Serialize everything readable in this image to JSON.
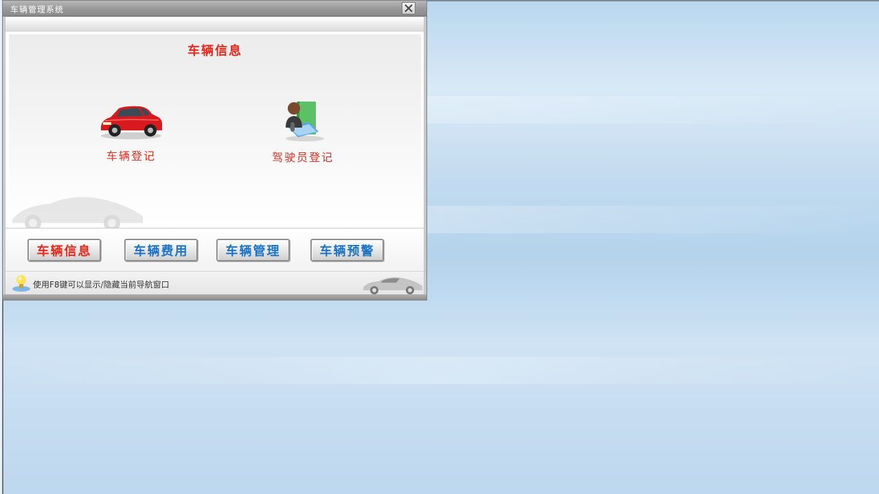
{
  "window": {
    "title": "车辆管理系统"
  },
  "panel": {
    "title": "车辆信息",
    "modules": [
      {
        "label": "车辆登记",
        "icon": "red-car-icon"
      },
      {
        "label": "驾驶员登记",
        "icon": "driver-book-icon"
      }
    ]
  },
  "nav_buttons": [
    {
      "label": "车辆信息",
      "state": "active"
    },
    {
      "label": "车辆费用",
      "state": "normal"
    },
    {
      "label": "车辆管理",
      "state": "normal"
    },
    {
      "label": "车辆预警",
      "state": "normal"
    }
  ],
  "status": {
    "text": "使用F8键可以显示/隐藏当前导航窗口",
    "icon": "lightbulb-icon"
  },
  "colors": {
    "accent_red": "#e8281c",
    "button_blue": "#1b73c4",
    "desktop_blue": "#c4dcf0"
  }
}
